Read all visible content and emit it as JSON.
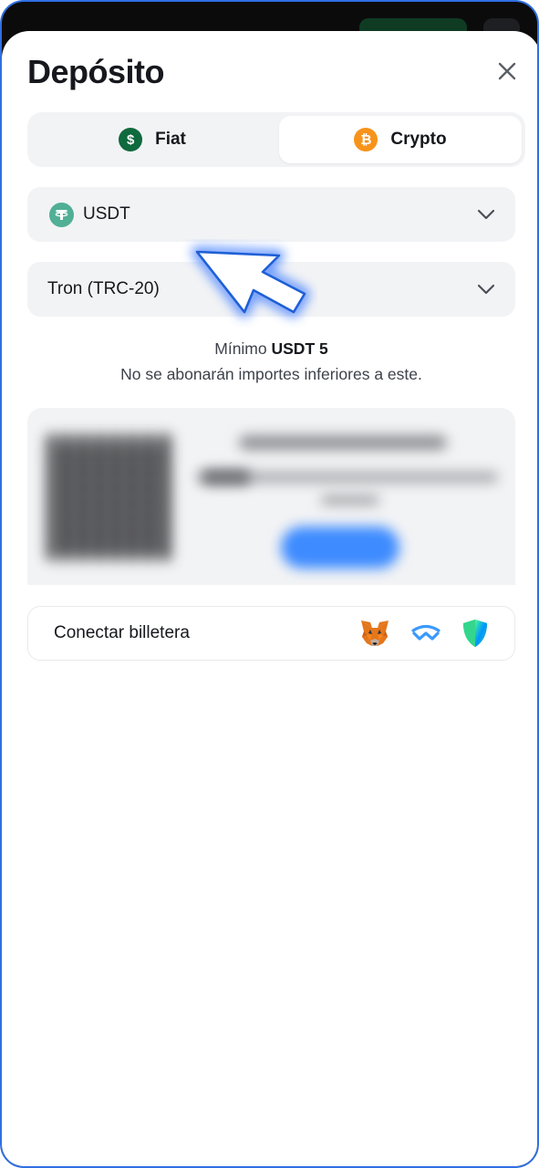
{
  "modal": {
    "title": "Depósito"
  },
  "tabs": [
    {
      "label": "Fiat",
      "icon": "dollar-coin-icon",
      "color": "#0f6a3d",
      "glyph": "$"
    },
    {
      "label": "Crypto",
      "icon": "bitcoin-icon",
      "color": "#f7931a",
      "glyph": "₿",
      "active": true
    }
  ],
  "asset_select": {
    "value": "USDT",
    "icon": "tether-icon",
    "icon_color": "#50af95"
  },
  "network_select": {
    "value": "Tron (TRC-20)"
  },
  "minimum": {
    "prefix": "Mínimo",
    "amount": "USDT 5",
    "note": "No se abonarán importes inferiores a este."
  },
  "wallet": {
    "label": "Conectar billetera",
    "icons": [
      "metamask-fox-icon",
      "walletconnect-icon",
      "trust-wallet-shield-icon"
    ]
  },
  "colors": {
    "frame_border": "#2f6fe3",
    "cursor_glow": "#3d7bff"
  }
}
